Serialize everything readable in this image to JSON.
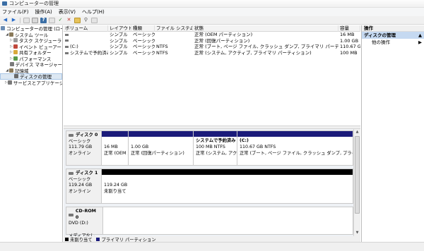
{
  "window": {
    "title": "コンピューターの管理"
  },
  "menu": [
    "ファイル(F)",
    "操作(A)",
    "表示(V)",
    "ヘルプ(H)"
  ],
  "tree": [
    {
      "label": "コンピューターの管理 (ローカル)",
      "indent": 0,
      "exp": "",
      "color": "#6b8db5"
    },
    {
      "label": "システム ツール",
      "indent": 1,
      "exp": "◢",
      "color": "#8a7a5a"
    },
    {
      "label": "タスク スケジューラ",
      "indent": 2,
      "exp": "▷",
      "color": "#9a9a9a"
    },
    {
      "label": "イベント ビューアー",
      "indent": 2,
      "exp": "▷",
      "color": "#c0483c"
    },
    {
      "label": "共有フォルダー",
      "indent": 2,
      "exp": "▷",
      "color": "#d9a93a"
    },
    {
      "label": "パフォーマンス",
      "indent": 2,
      "exp": "▷",
      "color": "#5a9a4a"
    },
    {
      "label": "デバイス マネージャー",
      "indent": 2,
      "exp": "",
      "color": "#7a7a7a"
    },
    {
      "label": "記憶域",
      "indent": 1,
      "exp": "◢",
      "color": "#8a7a5a"
    },
    {
      "label": "ディスクの管理",
      "indent": 2,
      "exp": "",
      "color": "#6a6a6a",
      "selected": true
    },
    {
      "label": "サービスとアプリケーション",
      "indent": 1,
      "exp": "▷",
      "color": "#7a7a7a"
    }
  ],
  "volumes": {
    "headers": [
      "ボリューム",
      "レイアウト",
      "種類",
      "ファイル システム",
      "状態",
      "容量"
    ],
    "rows": [
      [
        "",
        "シンプル",
        "ベーシック",
        "",
        "正常 (OEM パーティション)",
        "16 MB"
      ],
      [
        "",
        "シンプル",
        "ベーシック",
        "",
        "正常 (回復パーティション)",
        "1.00 GB"
      ],
      [
        "(C:)",
        "シンプル",
        "ベーシック",
        "NTFS",
        "正常 (ブート, ページ ファイル, クラッシュ ダンプ, プライマリ パーティション)",
        "110.67 G"
      ],
      [
        "システムで予約済み",
        "シンプル",
        "ベーシック",
        "NTFS",
        "正常 (システム, アクティブ, プライマリ パーティション)",
        "100 MB"
      ]
    ]
  },
  "disks": [
    {
      "name": "ディスク 0",
      "type": "ベーシック",
      "size": "111.79 GB",
      "status": "オンライン",
      "partitions": [
        {
          "title": "",
          "l1": "16 MB",
          "l2": "正常 (OEM パー",
          "bar": "blue",
          "w": 37
        },
        {
          "title": "",
          "l1": "1.00 GB",
          "l2": "正常 (回復パーティション)",
          "bar": "blue",
          "w": 92
        },
        {
          "title": "システムで予約済み",
          "l1": "100 MB NTFS",
          "l2": "正常 (システム, アク",
          "bar": "blue",
          "w": 62
        },
        {
          "title": "(C:)",
          "l1": "110.67 GB NTFS",
          "l2": "正常 (ブート, ページ ファイル, クラッシュ ダンプ, プライマ",
          "bar": "blue",
          "w": 164
        }
      ]
    },
    {
      "name": "ディスク 1",
      "type": "ベーシック",
      "size": "119.24 GB",
      "status": "オンライン",
      "partitions": [
        {
          "title": "",
          "l1": "119.24 GB",
          "l2": "未割り当て",
          "bar": "black",
          "w": 355
        }
      ]
    },
    {
      "name": "CD-ROM 0",
      "type": "DVD (D:)",
      "size": "",
      "status": "メディアなし",
      "partitions": []
    }
  ],
  "legend": [
    {
      "label": "未割り当て",
      "color": "#000000"
    },
    {
      "label": "プライマリ パーティション",
      "color": "#1b1b7a"
    }
  ],
  "actions": {
    "header": "操作",
    "section": "ディスクの管理",
    "item": "他の操作"
  }
}
